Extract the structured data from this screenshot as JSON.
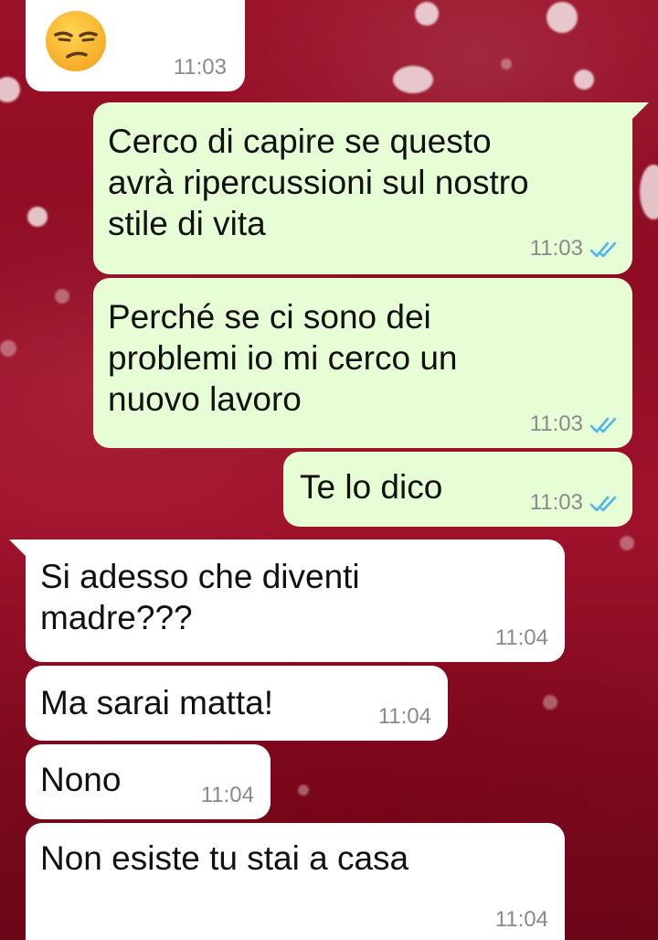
{
  "messages": [
    {
      "dir": "in",
      "emoji": "unamused-face",
      "time": "11:03"
    },
    {
      "dir": "out",
      "text": "Cerco di capire se questo\navrà ripercussioni sul nostro\nstile di vita",
      "time": "11:03",
      "status": "read"
    },
    {
      "dir": "out",
      "text": "Perché se ci sono dei\nproblemi io mi cerco un\nnuovo lavoro",
      "time": "11:03",
      "status": "read"
    },
    {
      "dir": "out",
      "text": "Te lo dico",
      "time": "11:03",
      "status": "read"
    },
    {
      "dir": "in",
      "text": "Si adesso che diventi\nmadre???",
      "time": "11:04"
    },
    {
      "dir": "in",
      "text": "Ma sarai matta!",
      "time": "11:04"
    },
    {
      "dir": "in",
      "text": "Nono",
      "time": "11:04"
    },
    {
      "dir": "in",
      "text": "Non esiste tu stai a casa",
      "time": "11:04"
    }
  ],
  "colors": {
    "incoming": "#ffffff",
    "outgoing": "#e7fdd6",
    "read_ticks": "#4fb6ec",
    "background": "#9a1028"
  }
}
